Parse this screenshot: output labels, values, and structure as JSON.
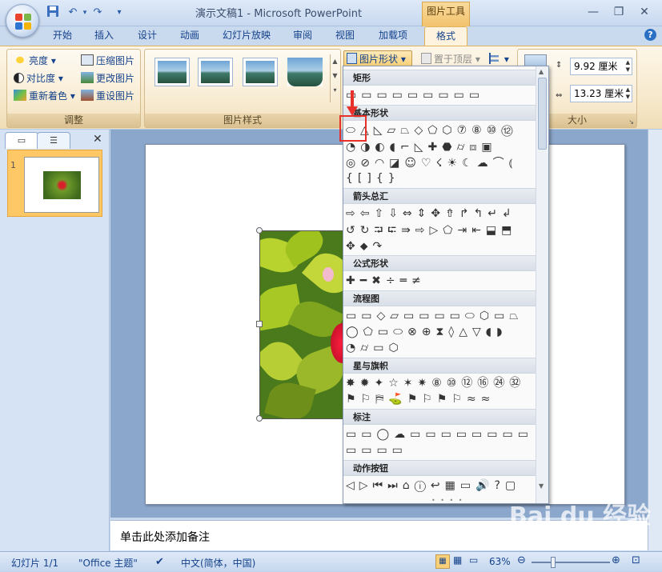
{
  "titlebar": {
    "title": "演示文稿1 - Microsoft PowerPoint",
    "context_group": "图片工具",
    "qat": {
      "save": "save-icon",
      "undo": "↶",
      "redo": "↷",
      "customize": "▾"
    },
    "window": {
      "minimize": "—",
      "restore": "❐",
      "close": "✕"
    }
  },
  "tabs": [
    {
      "label": "开始"
    },
    {
      "label": "插入"
    },
    {
      "label": "设计"
    },
    {
      "label": "动画"
    },
    {
      "label": "幻灯片放映"
    },
    {
      "label": "审阅"
    },
    {
      "label": "视图"
    },
    {
      "label": "加载项"
    },
    {
      "label": "格式",
      "active": true
    }
  ],
  "ribbon": {
    "adjust": {
      "label": "调整",
      "brightness": "亮度",
      "contrast": "对比度",
      "recolor": "重新着色",
      "compress": "压缩图片",
      "change": "更改图片",
      "reset": "重设图片"
    },
    "styles": {
      "label": "图片样式"
    },
    "picture_shape": "图片形状",
    "bring_front": "置于顶层",
    "size": {
      "label": "大小",
      "height": "9.92 厘米",
      "width": "13.23 厘米"
    }
  },
  "left_panel": {
    "slide_number": "1"
  },
  "notes": {
    "placeholder": "单击此处添加备注"
  },
  "status": {
    "slide": "幻灯片 1/1",
    "theme": "\"Office 主题\"",
    "language": "中文(简体，中国)",
    "zoom": "63%"
  },
  "gallery": {
    "categories": [
      {
        "title": "矩形",
        "rows": [
          "▭▭▭▭▭▭▭▭▭"
        ]
      },
      {
        "title": "基本形状",
        "rows": [
          "⬭△◺▱⏢◇⬠⬡⑦⑧⑩⑫",
          "◔◑◐◖⌐◺✚⬣⌭⧈▣",
          "◎⊘◠◪☺♡☇☀☾☁⌒⦅",
          "{[]{}"
        ]
      },
      {
        "title": "箭头总汇",
        "rows": [
          "⇨⇦⇧⇩⇔⇕✥⇮↱↰↵↲",
          "↺↻⮒⮓⇛⇨▷⬠⇥⇤⬓⬒",
          "✥⬥↷"
        ]
      },
      {
        "title": "公式形状",
        "rows": [
          "✚━✖÷═≠"
        ]
      },
      {
        "title": "流程图",
        "rows": [
          "▭▭◇▱▭▭▭▭⬭⬡▭⏢",
          "◯⬠▭⬭⊗⊕⧗◊△▽◖◗",
          "◔⌭▭⬡"
        ]
      },
      {
        "title": "星与旗帜",
        "rows": [
          "✸✹✦☆✶✷⑧⑩⑫⑯㉔㉜",
          "⚑⚐⛿⛳⚑⚐⚑⚐≈≈"
        ]
      },
      {
        "title": "标注",
        "rows": [
          "▭▭◯☁▭▭▭▭▭▭▭▭",
          "▭▭▭▭"
        ]
      },
      {
        "title": "动作按钮",
        "rows": [
          "◁▷⏮⏭⌂ⓘ↩▦▭🔊?▢"
        ]
      }
    ]
  }
}
